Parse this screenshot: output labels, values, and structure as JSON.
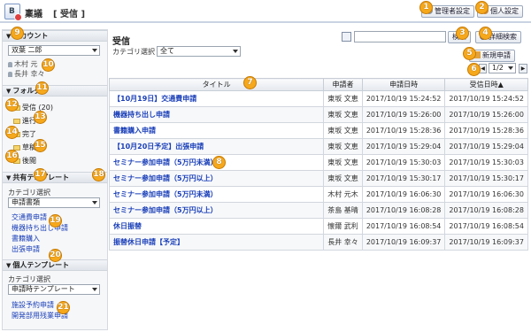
{
  "app": {
    "title": "稟議",
    "subtitle": "[ 受信 ]"
  },
  "header": {
    "admin_settings": "管理者設定",
    "personal_settings": "個人設定"
  },
  "main": {
    "title": "受信",
    "category_label": "カテゴリ選択",
    "category_value": "全て",
    "search_button": "検索",
    "advanced_search": "詳細検索",
    "new_request": "新規申請",
    "pager": "1/2"
  },
  "sidebar": {
    "account_head": "アカウント",
    "account_value": "双葉 二郎",
    "accounts": [
      "木村 元",
      "長井 幸々"
    ],
    "folder_head": "フォルダ",
    "folders": [
      "受信 (20)",
      "進行",
      "完了",
      "草稿",
      "後閲"
    ],
    "shared_head": "共有テンプレート",
    "shared_category_label": "カテゴリ選択",
    "shared_category_value": "申請書類",
    "shared_templates": [
      "交通費申請",
      "機器持ち出し申請",
      "書籍購入",
      "出張申請"
    ],
    "personal_head": "個人テンプレート",
    "personal_category_label": "カテゴリ選択",
    "personal_category_value": "申請時テンプレート",
    "personal_templates": [
      "施設予約申請",
      "開発部用残業申請"
    ]
  },
  "table": {
    "headers": [
      "タイトル",
      "申請者",
      "申請日時",
      "受信日時▲"
    ],
    "rows": [
      [
        "【10月19日】交通費申請",
        "東坂 文恵",
        "2017/10/19 15:24:52",
        "2017/10/19 15:24:52"
      ],
      [
        "機器持ち出し申請",
        "東坂 文恵",
        "2017/10/19 15:26:00",
        "2017/10/19 15:26:00"
      ],
      [
        "書籍購入申請",
        "東坂 文恵",
        "2017/10/19 15:28:36",
        "2017/10/19 15:28:36"
      ],
      [
        "【10月20日予定】出張申請",
        "東坂 文恵",
        "2017/10/19 15:29:04",
        "2017/10/19 15:29:04"
      ],
      [
        "セミナー参加申請（5万円未満）",
        "東坂 文恵",
        "2017/10/19 15:30:03",
        "2017/10/19 15:30:03"
      ],
      [
        "セミナー参加申請（5万円以上）",
        "東坂 文恵",
        "2017/10/19 15:30:17",
        "2017/10/19 15:30:17"
      ],
      [
        "セミナー参加申請（5万円未満）",
        "木村 元木",
        "2017/10/19 16:06:30",
        "2017/10/19 16:06:30"
      ],
      [
        "セミナー参加申請（5万円以上）",
        "茶島 基晴",
        "2017/10/19 16:08:28",
        "2017/10/19 16:08:28"
      ],
      [
        "休日振替",
        "懐爾 武利",
        "2017/10/19 16:08:54",
        "2017/10/19 16:08:54"
      ],
      [
        "振替休日申請【予定】",
        "長井 幸々",
        "2017/10/19 16:09:37",
        "2017/10/19 16:09:37"
      ]
    ]
  },
  "badges": [
    "1",
    "2",
    "3",
    "4",
    "5",
    "6",
    "7",
    "8",
    "9",
    "10",
    "11",
    "12",
    "13",
    "14",
    "15",
    "16",
    "17",
    "18",
    "19",
    "20",
    "21"
  ],
  "colors": {
    "badge": "#f6a81c",
    "link": "#1a3fb8"
  }
}
